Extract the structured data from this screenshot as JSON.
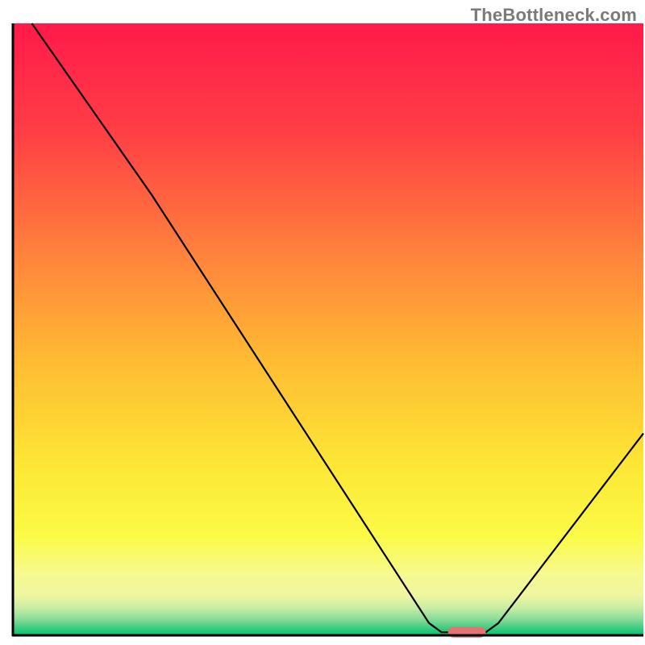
{
  "watermark": "TheBottleneck.com",
  "chart_data": {
    "type": "line",
    "title": "",
    "xlabel": "",
    "ylabel": "",
    "xlim": [
      0,
      100
    ],
    "ylim": [
      0,
      100
    ],
    "line": {
      "name": "bottleneck-curve",
      "points": [
        {
          "x": 3,
          "y": 100
        },
        {
          "x": 22,
          "y": 72
        },
        {
          "x": 66,
          "y": 2
        },
        {
          "x": 68,
          "y": 0.5
        },
        {
          "x": 75,
          "y": 0.5
        },
        {
          "x": 77,
          "y": 2
        },
        {
          "x": 100,
          "y": 33
        }
      ]
    },
    "optimal_marker": {
      "x_start": 69,
      "x_end": 75,
      "y": 0.5,
      "color": "#e57373"
    },
    "background_gradient": {
      "type": "vertical",
      "stops": [
        {
          "offset": 0.0,
          "color": "#ff1a4a"
        },
        {
          "offset": 0.18,
          "color": "#ff3f45"
        },
        {
          "offset": 0.38,
          "color": "#ff833c"
        },
        {
          "offset": 0.55,
          "color": "#ffbb33"
        },
        {
          "offset": 0.72,
          "color": "#fde635"
        },
        {
          "offset": 0.84,
          "color": "#fbfb47"
        },
        {
          "offset": 0.9,
          "color": "#f7fa90"
        },
        {
          "offset": 0.935,
          "color": "#eef6a0"
        },
        {
          "offset": 0.955,
          "color": "#c9eda3"
        },
        {
          "offset": 0.972,
          "color": "#8fde9a"
        },
        {
          "offset": 0.985,
          "color": "#4fce86"
        },
        {
          "offset": 1.0,
          "color": "#00c36b"
        }
      ]
    },
    "axes": {
      "color": "#000000",
      "width": 3
    }
  }
}
